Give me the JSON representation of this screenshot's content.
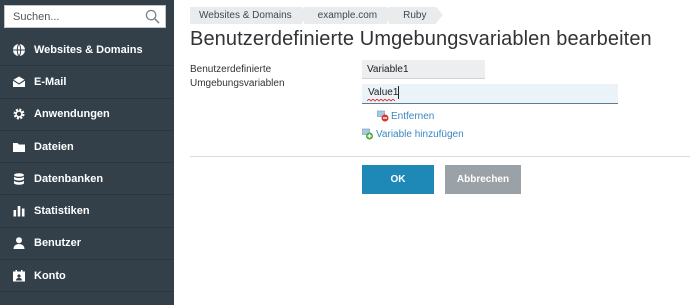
{
  "search": {
    "placeholder": "Suchen..."
  },
  "sidebar": {
    "items": [
      {
        "label": "Websites & Domains",
        "icon": "globe-icon"
      },
      {
        "label": "E-Mail",
        "icon": "envelope-icon"
      },
      {
        "label": "Anwendungen",
        "icon": "gear-icon"
      },
      {
        "label": "Dateien",
        "icon": "folder-icon"
      },
      {
        "label": "Datenbanken",
        "icon": "database-icon"
      },
      {
        "label": "Statistiken",
        "icon": "bar-chart-icon"
      },
      {
        "label": "Benutzer",
        "icon": "user-icon"
      },
      {
        "label": "Konto",
        "icon": "account-card-icon"
      }
    ]
  },
  "breadcrumb": [
    "Websites & Domains",
    "example.com",
    "Ruby"
  ],
  "page": {
    "title": "Benutzerdefinierte Umgebungsvariablen bearbeiten",
    "field_label_line1": "Benutzerdefinierte",
    "field_label_line2": "Umgebungsvariablen",
    "variable_name": "Variable1",
    "variable_value": "Value1",
    "remove_label": "Entfernen",
    "add_label": "Variable hinzufügen"
  },
  "buttons": {
    "ok": "OK",
    "cancel": "Abbrechen"
  },
  "colors": {
    "sidebar_bg": "#33404a",
    "primary": "#1e88b6",
    "secondary": "#9aa2a7",
    "link": "#3a87c0"
  }
}
